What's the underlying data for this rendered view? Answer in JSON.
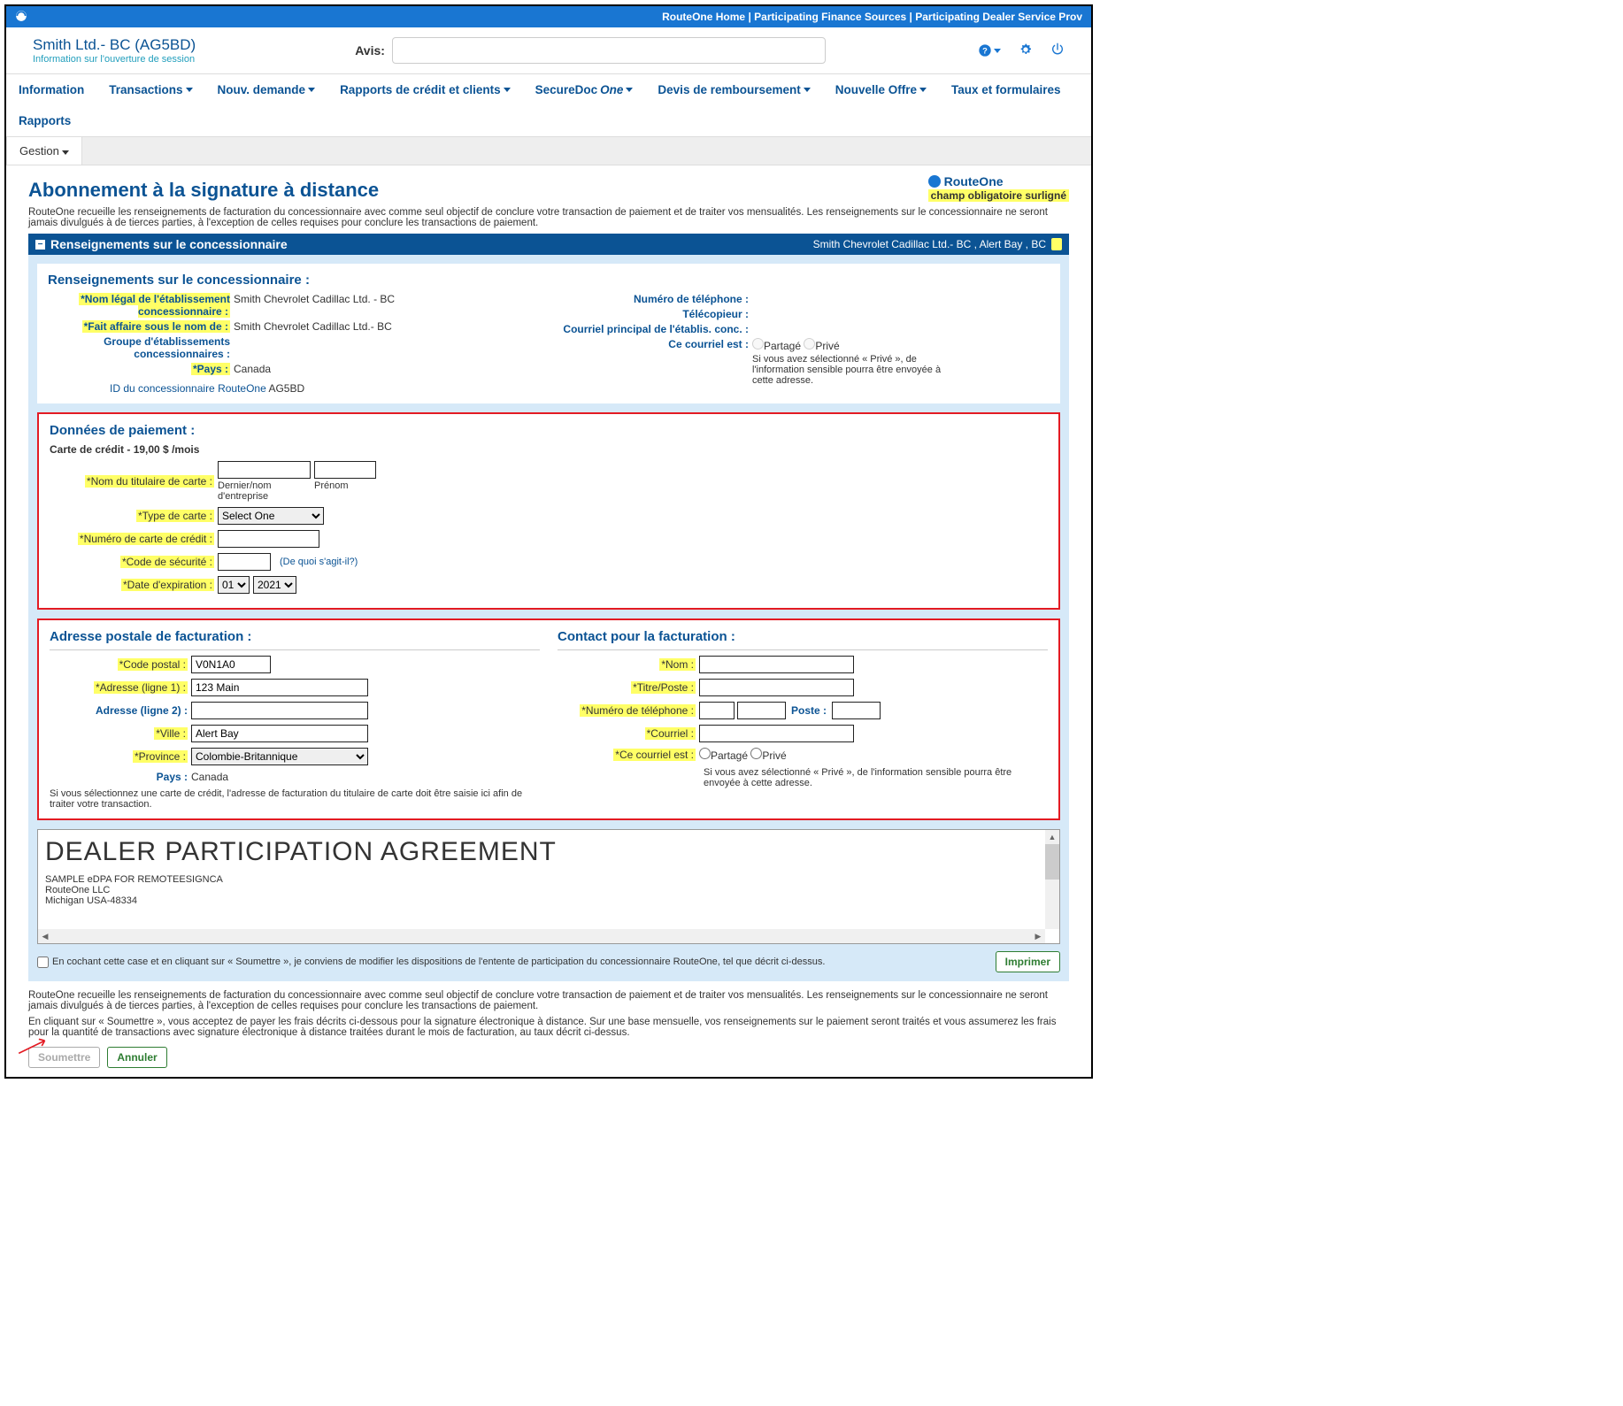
{
  "topbar": {
    "home": "RouteOne Home",
    "finance": "Participating Finance Sources",
    "dealer_svc": "Participating Dealer Service Prov"
  },
  "header": {
    "dealer_name": "Smith Ltd.- BC (AG5BD)",
    "session_info": "Information sur l'ouverture de session",
    "avis_label": "Avis:"
  },
  "nav": {
    "information": "Information",
    "transactions": "Transactions",
    "nouv_demande": "Nouv. demande",
    "rapports": "Rapports de crédit et clients",
    "securedoc": "SecureDoc",
    "securedoc_one": "One",
    "devis": "Devis de remboursement",
    "nouvelle_offre": "Nouvelle Offre",
    "taux": "Taux et formulaires",
    "rapports2": "Rapports",
    "gestion": "Gestion"
  },
  "page": {
    "title": "Abonnement à la signature à distance",
    "brand": "RouteOne",
    "highlight": "champ obligatoire surligné",
    "intro": "RouteOne recueille les renseignements de facturation du concessionnaire avec comme seul objectif de conclure votre transaction de paiement et de traiter vos mensualités. Les renseignements sur le concessionnaire ne seront jamais divulgués à de tierces parties, à l'exception de celles requises pour conclure les transactions de paiement."
  },
  "section_header": {
    "title": "Renseignements sur le concessionnaire",
    "right": "Smith Chevrolet Cadillac Ltd.- BC , Alert Bay , BC"
  },
  "dealer": {
    "section": "Renseignements sur le concessionnaire :",
    "legal_label": "*Nom légal de l'établissement concessionnaire :",
    "legal_value": "Smith Chevrolet Cadillac Ltd. - BC",
    "dba_label": "*Fait affaire sous le nom de :",
    "dba_value": "Smith Chevrolet Cadillac Ltd.- BC",
    "group_label": "Groupe d'établissements concessionnaires :",
    "country_label": "*Pays :",
    "country_value": "Canada",
    "id_label": "ID du concessionnaire RouteOne",
    "id_value": "AG5BD",
    "phone_label": "Numéro de téléphone :",
    "fax_label": "Télécopieur :",
    "email_label": "Courriel principal de l'établis. conc. :",
    "email_is_label": "Ce courriel est :",
    "shared": "Partagé",
    "private": "Privé",
    "email_note": "Si vous avez sélectionné « Privé », de l'information sensible pourra être envoyée à cette adresse."
  },
  "payment": {
    "section": "Données de paiement :",
    "cc_sub": "Carte de crédit -  19,00 $ /mois",
    "cardholder": "*Nom du titulaire de carte :",
    "last_biz": "Dernier/nom d'entreprise",
    "first": "Prénom",
    "card_type": "*Type de carte :",
    "select_one": "Select One",
    "cc_num": "*Numéro de carte de crédit :",
    "sec_code": "*Code de sécurité :",
    "sec_link": "(De quoi s'agit-il?)",
    "exp": "*Date d'expiration :",
    "month": "01",
    "year": "2021"
  },
  "billing": {
    "section": "Adresse postale de facturation :",
    "zip_label": "*Code postal :",
    "zip_value": "V0N1A0",
    "addr1_label": "*Adresse (ligne 1) :",
    "addr1_value": "123 Main",
    "addr2_label": "Adresse (ligne 2) :",
    "city_label": "*Ville :",
    "city_value": "Alert Bay",
    "prov_label": "*Province :",
    "prov_value": "Colombie-Britannique",
    "country_label": "Pays :",
    "country_value": "Canada",
    "note": "Si vous sélectionnez une carte de crédit, l'adresse de facturation du titulaire de carte doit être saisie ici afin de traiter votre transaction."
  },
  "contact": {
    "section": "Contact pour la facturation :",
    "name_label": "*Nom :",
    "title_label": "*Titre/Poste :",
    "phone_label": "*Numéro de téléphone :",
    "ext_label": "Poste :",
    "email_label": "*Courriel :",
    "email_is_label": "*Ce courriel est :",
    "shared": "Partagé",
    "private": "Privé",
    "note": "Si vous avez sélectionné « Privé », de l'information sensible pourra être envoyée à cette adresse."
  },
  "agreement": {
    "title": "DEALER PARTICIPATION AGREEMENT",
    "line1": "SAMPLE eDPA FOR REMOTEESIGNCA",
    "line2": "RouteOne LLC",
    "line3": "Michigan USA-48334",
    "checkbox_text": "En cochant cette case et en cliquant sur « Soumettre », je conviens de modifier les dispositions de l'entente de participation du concessionnaire RouteOne, tel que décrit ci-dessus.",
    "print": "Imprimer"
  },
  "footer": {
    "note1": "RouteOne recueille les renseignements de facturation du concessionnaire avec comme seul objectif de conclure votre transaction de paiement et de traiter vos mensualités. Les renseignements sur le concessionnaire ne seront jamais divulgués à de tierces parties, à l'exception de celles requises pour conclure les transactions de paiement.",
    "note2": "En cliquant sur « Soumettre », vous acceptez de payer les frais décrits ci-dessous pour la signature électronique à distance. Sur une base mensuelle, vos renseignements sur le paiement seront traités et vous assumerez les frais pour la quantité de transactions avec signature électronique à distance traitées durant le mois de facturation, au taux décrit ci-dessus.",
    "submit": "Soumettre",
    "cancel": "Annuler"
  }
}
